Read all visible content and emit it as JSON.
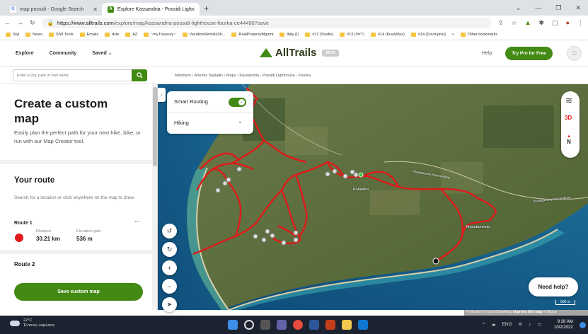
{
  "browser": {
    "tabs": [
      {
        "label": "map possidi - Google Search",
        "favicon": "G",
        "color": "#4285f4",
        "active": false
      },
      {
        "label": "Explore Kassandria - Possidi Ligh",
        "favicon": "A",
        "color": "#428a13",
        "active": true
      }
    ],
    "url_host": "https://www.alltrails.com",
    "url_path": "/explore/map/kassandria-possidi-lighthouse-fourka-ce44496?save",
    "bookmarks": [
      "Styl",
      "News",
      "S/W Tools",
      "Emails",
      "Arte",
      "AZ",
      "~myTreasury~",
      "VacationRentalsSh...",
      "RealPropertyMgmnt",
      "Italy (I)",
      "#12 (Studio)",
      "#13 (VrrT)",
      "#14 (Κυκλάδες)",
      "#14 (Σαντορίνη)",
      "»",
      "Other bookmarks"
    ]
  },
  "nav": {
    "explore": "Explore",
    "community": "Community",
    "saved": "Saved ⌄",
    "logo": "AllTrails",
    "beta": "BETA",
    "help": "Help",
    "try_pro": "Try Pro for Free"
  },
  "search": {
    "placeholder": "Enter a city, park or trail name"
  },
  "breadcrumbs": "Members › Artemis Styliadis › Maps › Kassandria - Possidi Lighthouse - Fourka",
  "sidebar": {
    "title": "Create a custom map",
    "subtitle": "Easily plan the perfect path for your next hike, bike, or run with our Map Creator tool.",
    "your_route": "Your route",
    "route_hint": "Search for a location or click anywhere on the map to draw",
    "route1": {
      "name": "Route 1",
      "distance_label": "Distance",
      "distance": "30.21 km",
      "elev_label": "Elevation gain",
      "elev": "536 m",
      "color": "#e01a1a"
    },
    "route2": {
      "name": "Route 2"
    },
    "save_button": "Save custom map"
  },
  "map_panel": {
    "smart_routing": "Smart Routing",
    "activity": "Hiking"
  },
  "map_controls": {
    "three_d": "3D",
    "north": "N",
    "need_help": "Need help?",
    "scale": "500 m"
  },
  "map_labels": {
    "kalandra": "Kalandra",
    "mpoutamesia": "Mpoutamesia",
    "road1": "Περιφερειακή Κασσάνδρας",
    "road2": "Περιφερειακή Κασσάνδρας"
  },
  "attribution": {
    "text": "© Mapbox © OpenStreetMap",
    "improve": "Improve this map",
    "maxar": "© Maxar"
  },
  "taskbar": {
    "temp": "22°C",
    "weather": "Έντονες νεφώσεις",
    "lang": "ENG",
    "time": "9:28 AM",
    "date": "10/2/2022"
  }
}
